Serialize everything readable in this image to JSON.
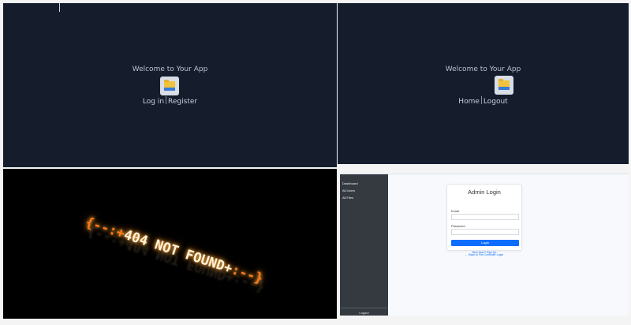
{
  "panel_landing": {
    "welcome": "Welcome to Your App",
    "icon": "file-folder-icon",
    "login_label": "Log in",
    "register_label": "Register"
  },
  "panel_home": {
    "welcome": "Welcome to Your App",
    "icon": "file-folder-icon",
    "home_label": "Home",
    "logout_label": "Logout"
  },
  "panel_error": {
    "open": "{--:+",
    "message": "404 NOT FOUND+",
    "close": ":--}",
    "reflection": "{--:+404 NOT FOUND+:--}"
  },
  "panel_admin": {
    "sidebar": {
      "items": [
        {
          "label": "Dashboard"
        },
        {
          "label": "All Users"
        },
        {
          "label": "All Files"
        }
      ],
      "logout_label": "Logout"
    },
    "card": {
      "title": "Admin Login",
      "email_label": "Email",
      "password_label": "Password",
      "login_button": "Login",
      "signup_text": "New User? Sign Up"
    },
    "back_link": "← Back to File Controller Login"
  },
  "colors": {
    "dark_bg": "#151d2d",
    "sidebar_bg": "#343a40",
    "primary": "#0d6efd",
    "neon": "#ff8a1c"
  }
}
